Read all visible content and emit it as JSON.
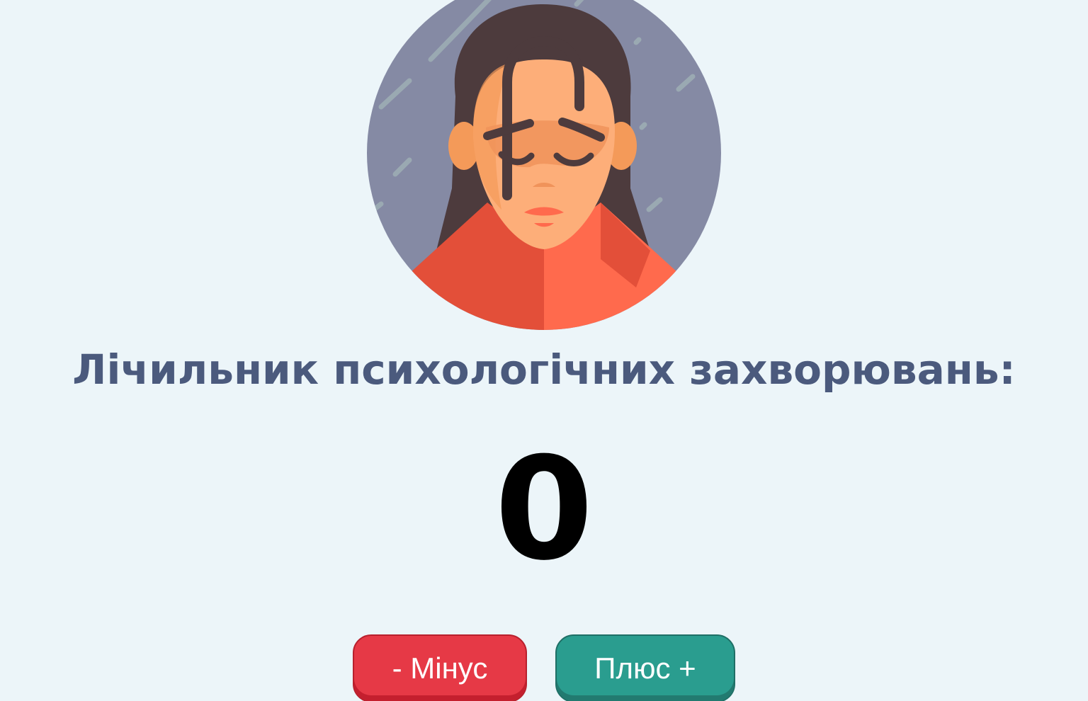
{
  "illustration": {
    "icon": "sad-woman-rain-icon",
    "colors": {
      "background_circle": "#858aa4",
      "hair": "#4d3b3d",
      "skin": "#fdae79",
      "skin_shadow": "#f49a59",
      "shirt_left": "#e34f39",
      "shirt_right": "#ff6a4d",
      "rain": "#9dacb4"
    }
  },
  "title": "Лічильник психологічних захворювань:",
  "counter": {
    "value": "0"
  },
  "buttons": {
    "minus_label": "- Мінус",
    "plus_label": "Плюс +",
    "minus_color": "#e63946",
    "plus_color": "#2a9d8f"
  }
}
